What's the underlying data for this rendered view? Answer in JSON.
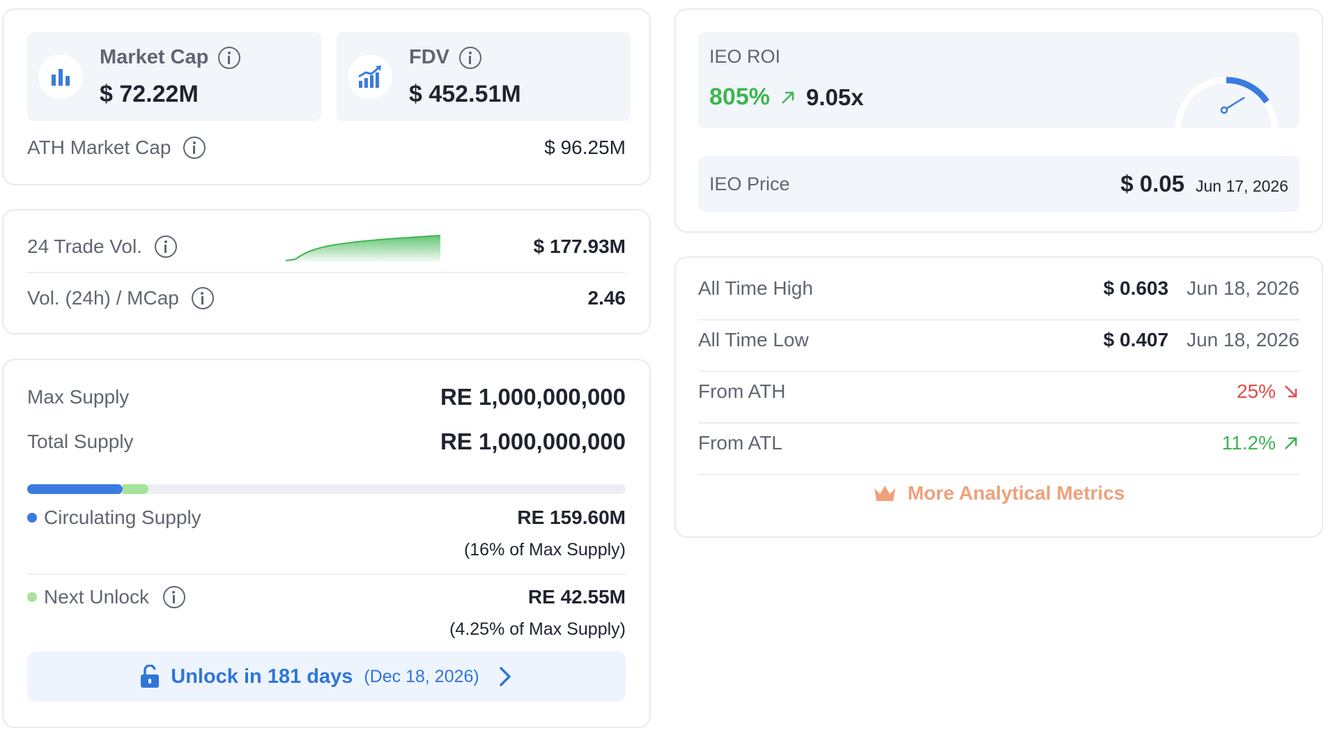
{
  "market_cap": {
    "label": "Market Cap",
    "value": "$ 72.22M",
    "icon": "bar-chart-icon"
  },
  "fdv": {
    "label": "FDV",
    "value": "$ 452.51M",
    "icon": "growth-chart-icon"
  },
  "ath_market_cap": {
    "label": "ATH Market Cap",
    "value": "$ 96.25M"
  },
  "trade_volume": {
    "label": "24 Trade Vol.",
    "value": "$ 177.93M",
    "sparkline_color": "#3fb552"
  },
  "vol_mcap": {
    "label": "Vol. (24h) / MCap",
    "value": "2.46"
  },
  "supply": {
    "max_label": "Max Supply",
    "max_value": "RE 1,000,000,000",
    "total_label": "Total Supply",
    "total_value": "RE 1,000,000,000",
    "circulating_fraction": 0.16,
    "next_unlock_fraction": 0.0425,
    "circulating_label": "Circulating Supply",
    "circulating_value": "RE 159.60M",
    "circulating_sub": "(16% of Max Supply)",
    "next_unlock_label": "Next Unlock",
    "next_unlock_value": "RE 42.55M",
    "next_unlock_sub": "(4.25% of Max Supply)",
    "unlock_text": "Unlock in 181 days",
    "unlock_date": "(Dec 18, 2026)",
    "colors": {
      "circulating": "#3a7be0",
      "unlock": "#a7e29a"
    }
  },
  "ieo": {
    "roi_label": "IEO ROI",
    "roi_percent": "805%",
    "roi_multiple": "9.05x",
    "price_label": "IEO Price",
    "price_value": "$ 0.05",
    "price_date": "Jun 17, 2026"
  },
  "ath": {
    "rows": [
      {
        "label": "All Time High",
        "value": "$ 0.603",
        "date": "Jun 18, 2026"
      },
      {
        "label": "All Time Low",
        "value": "$ 0.407",
        "date": "Jun 18, 2026"
      }
    ],
    "from_ath_label": "From ATH",
    "from_ath_value": "25%",
    "from_atl_label": "From ATL",
    "from_atl_value": "11.2%",
    "more_label": "More Analytical Metrics"
  }
}
